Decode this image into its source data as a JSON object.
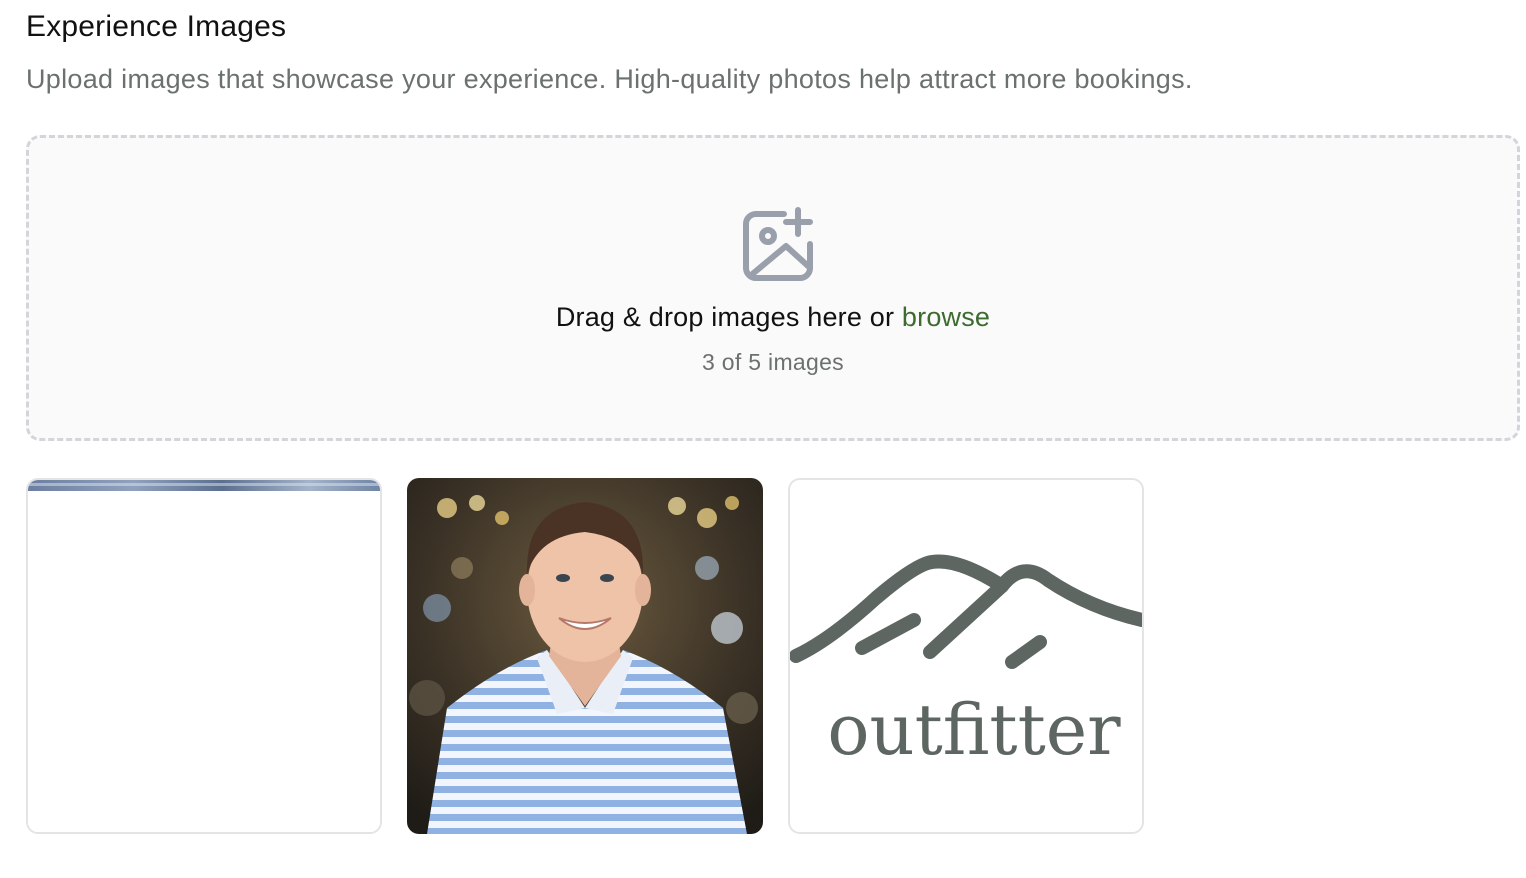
{
  "section": {
    "title": "Experience Images",
    "subtitle": "Upload images that showcase your experience. High-quality photos help attract more bookings."
  },
  "dropzone": {
    "icon": "image-plus-icon",
    "text": "Drag & drop images here or ",
    "browse_label": "browse",
    "count_text": "3 of 5 images"
  },
  "images": [
    {
      "name": "mountain-landscape-image",
      "state": "partially-loaded"
    },
    {
      "name": "portrait-photo",
      "state": "loaded"
    },
    {
      "name": "outfitter-logo-image",
      "state": "loaded",
      "logo_text": "outfitter"
    }
  ],
  "colors": {
    "link": "#3d6b2f",
    "muted_text": "#6b716d",
    "dropzone_border": "#d3d5da",
    "icon": "#9aa0ab",
    "logo": "#5d6660"
  }
}
